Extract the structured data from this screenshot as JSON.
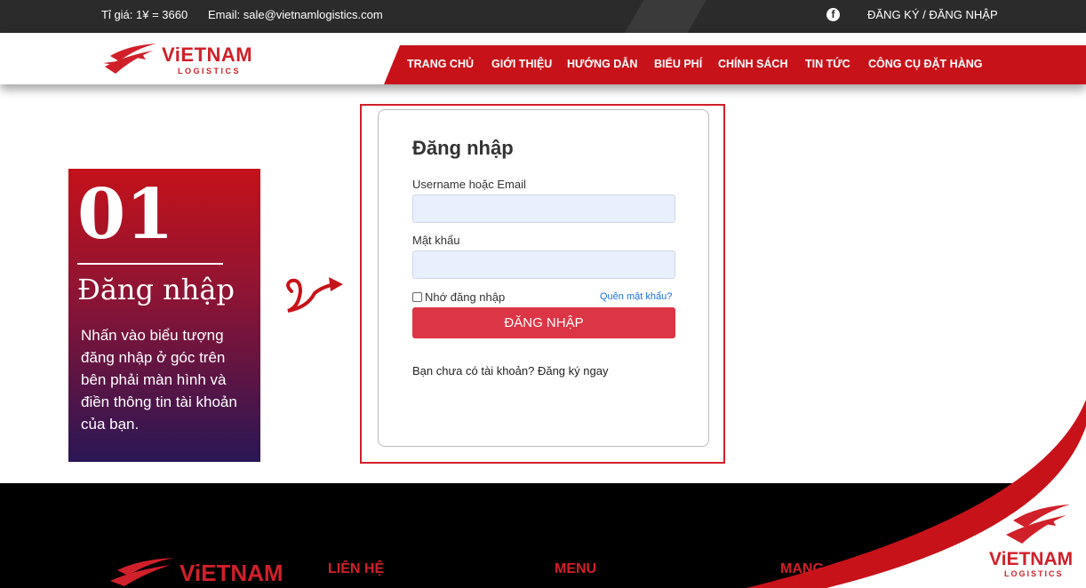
{
  "topbar": {
    "rate": "Tỉ giá: 1¥ = 3660",
    "email": "Email: sale@vietnamlogistics.com",
    "facebook_icon": "facebook-icon",
    "facebook_glyph": "f",
    "auth_link": "ĐĂNG KÝ / ĐĂNG NHẬP"
  },
  "brand": {
    "name": "ViETNAM",
    "tagline": "LOGISTICS",
    "color": "#d0202a"
  },
  "nav": {
    "items": [
      "TRANG CHỦ",
      "GIỚI THIỆU",
      "HƯỚNG DẪN",
      "BIỂU PHÍ",
      "CHÍNH SÁCH",
      "TIN TỨC",
      "CÔNG CỤ ĐẶT HÀNG"
    ],
    "background": "#c8121a"
  },
  "step": {
    "number": "01",
    "title": "Đăng nhập",
    "description": "Nhấn vào biểu tượng đăng nhập ở góc trên bên phải màn hình và điền thông tin tài khoản của bạn."
  },
  "login": {
    "heading": "Đăng nhập",
    "username_label": "Username hoặc Email",
    "username_value": "",
    "password_label": "Mật khẩu",
    "password_value": "",
    "remember_label": "Nhớ đăng nhập",
    "remember_checked": false,
    "forgot_link": "Quên mật khẩu?",
    "submit_label": "ĐĂNG NHẬP",
    "signup_text": "Bạn chưa có tài khoản? Đăng ký ngay",
    "button_color": "#dc3545"
  },
  "footer": {
    "columns": [
      "LIÊN HỆ",
      "MENU",
      "MANG"
    ]
  }
}
